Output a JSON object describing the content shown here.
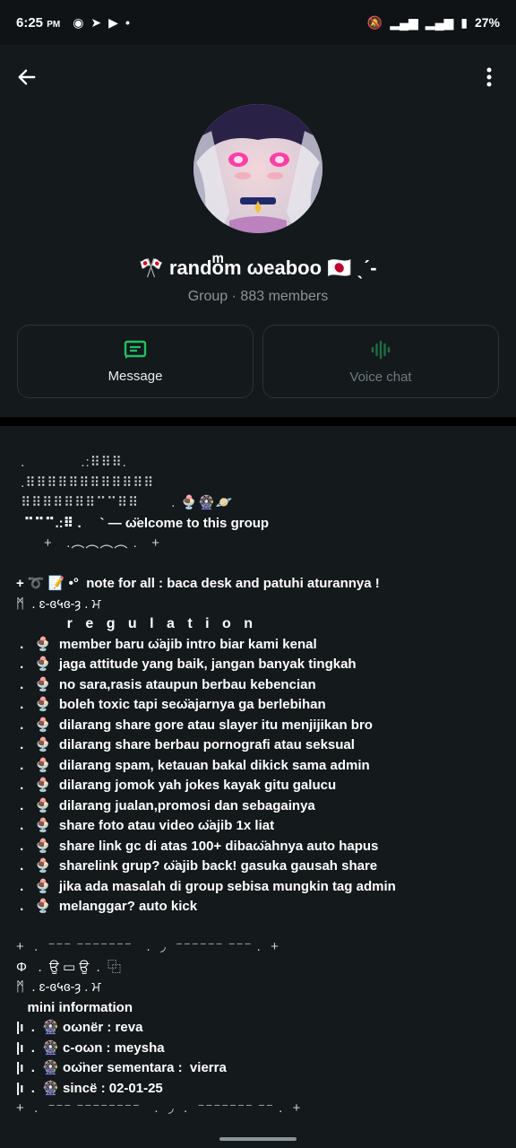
{
  "status_bar": {
    "time": "6:25",
    "ampm": "PM",
    "battery": "27%"
  },
  "header": {
    "group_name": "🎌 randoͫm ωeaboo 🇯🇵 ˎˊ-",
    "meta": "Group · 883 members",
    "message_label": "Message",
    "voice_chat_label": "Voice chat",
    "accent_color": "#21c063"
  },
  "description": {
    "lines": [
      " .            .:⠿⠿⠿.",
      " .⠿⠿⠿⠿⠿⠿⠿⠿⠿⠿⠿⠿",
      " ⠿⠿⠿⠿⠿⠿⠿⠉⠉⠿⠿       . 🍨🎡🪐",
      "  ⠉⠉⠉.:⠿ .     ` — ω̈elcome to this group",
      "      +   .︵︵︵︵ .   +",
      "",
      "+ ➰ 📝 •°  note for all : baca desk and patuhi aturannya !",
      "ᛗ  . ɛ-ɞ५ɞ-ȝ . ਮ",
      "      r e g u l a t i o n",
      " .   🍨  member baru ω̈ajib intro biar kami kenal",
      " .   🍨  jaga attitude yang baik, jangan banyak tingkah",
      " .   🍨  no sara,rasis ataupun berbau kebencian",
      " .   🍨  boleh toxic tapi seω̈ajarnya ga berlebihan",
      " .   🍨  dilarang share gore atau slayer itu menjijikan bro",
      " .   🍨  dilarang share berbau pornografi atau seksual",
      " .   🍨  dilarang spam, ketauan bakal dikick sama admin",
      " .   🍨  dilarang jomok yah jokes kayak gitu galucu",
      " .   🍨  dilarang jualan,promosi dan sebagainya",
      " .   🍨  share foto atau video ω̈ajib 1x liat",
      " .   🍨  share link gc di atas 100+ dibaω̈ahnya auto hapus",
      " .   🍨  sharelink grup? ω̈ajib back! gasuka gausah share",
      " .   🍨  jika ada masalah di group sebisa mungkin tag admin",
      " .   🍨  melanggar? auto kick",
      "",
      "+  .  ⁻⁻⁻ ⁻⁻⁻⁻⁻⁻⁻   .  ◞  ⁻⁻⁻⁻⁻⁻ ⁻⁻⁻ .  +",
      "Φ   .  ਉ ▭ ਉ  .  ⿻",
      "ᛗ  . ɛ-ɞ५ɞ-ȝ . ਮ",
      "   mini information",
      "|ı  .  🎡 oωnёr : reva",
      "|ı  .  🎡 c-oωn : meysha",
      "|ı  .  🎡 oω̈ner sementara :  vierra",
      "|ı  .  🎡 sincё : 02-01-25",
      "+  .  ⁻⁻⁻ ⁻⁻⁻⁻⁻⁻⁻⁻   .  ◞  .  ⁻⁻⁻⁻⁻⁻⁻ ⁻⁻ .  +"
    ]
  }
}
